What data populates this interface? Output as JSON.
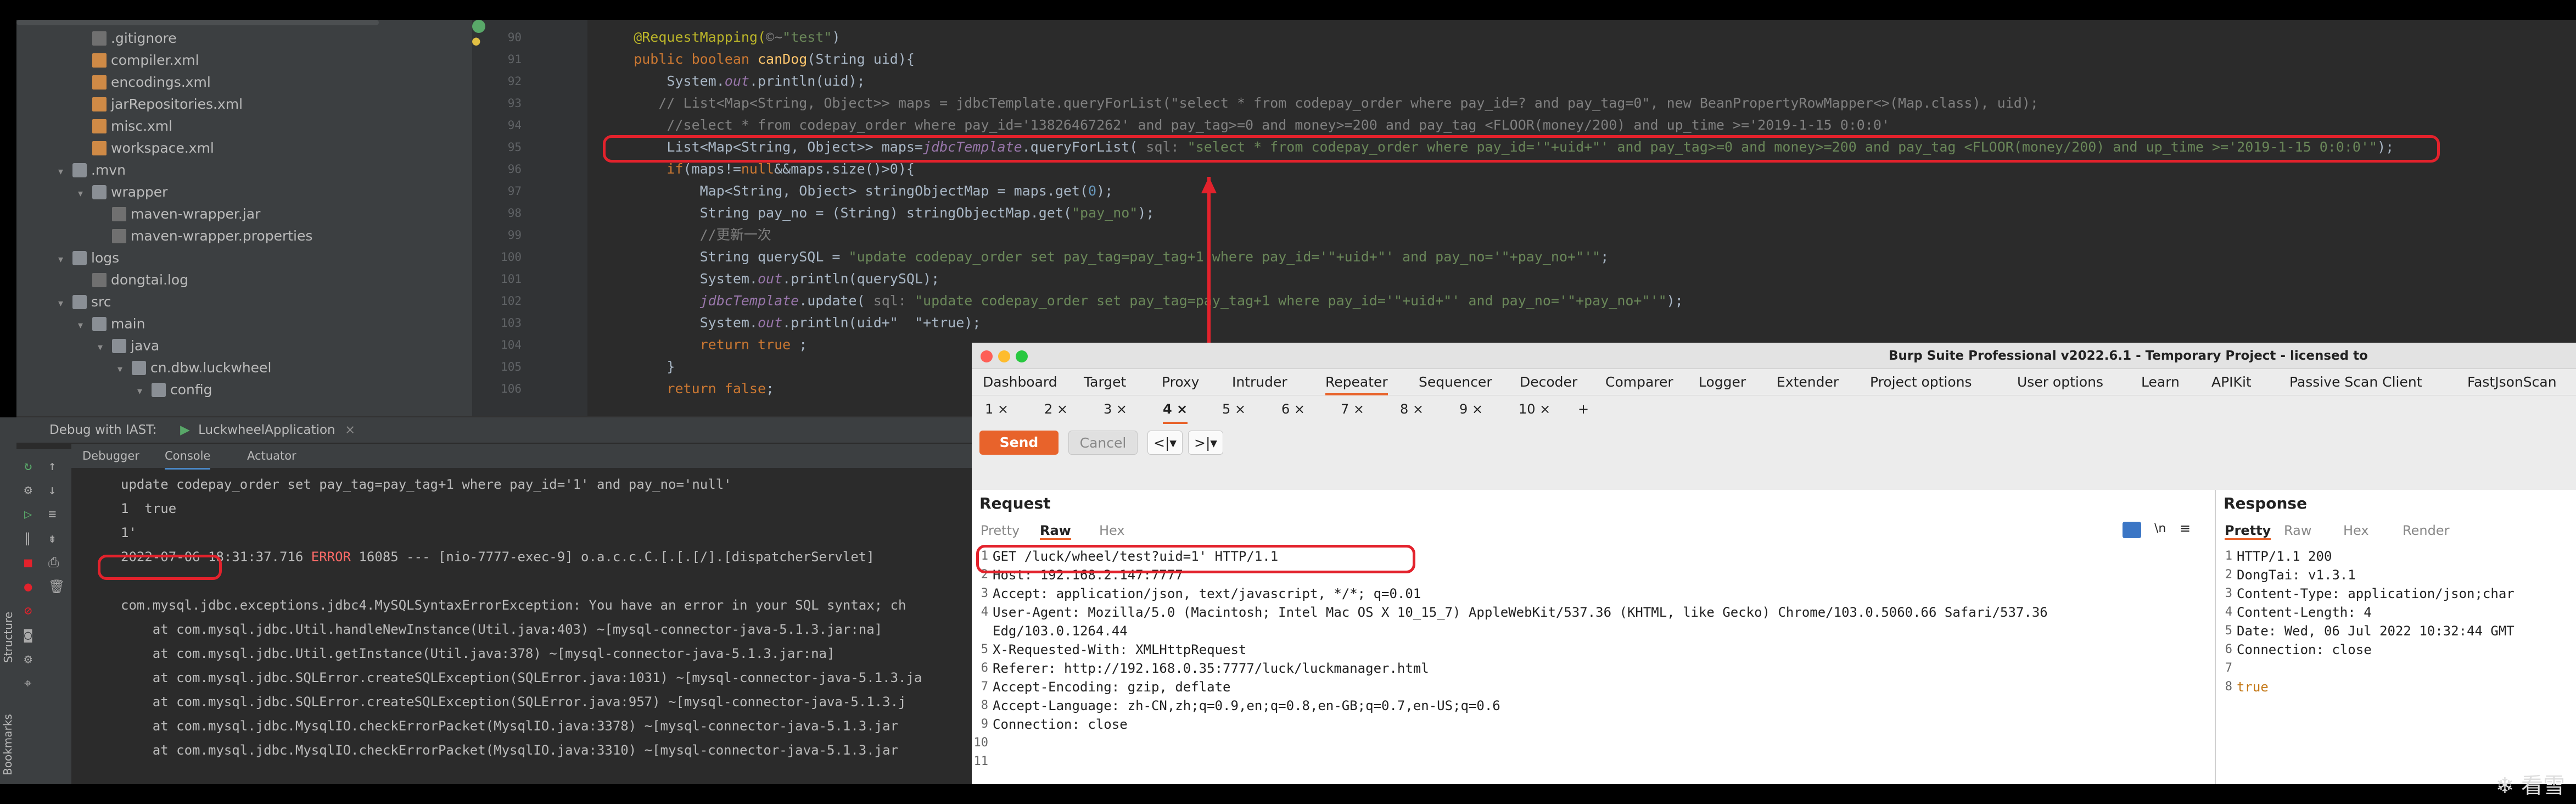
{
  "tree": [
    {
      "label": ".gitignore",
      "depth": 2,
      "icon": "file-icon",
      "arrow": ""
    },
    {
      "label": "compiler.xml",
      "depth": 2,
      "icon": "xml-file-icon",
      "arrow": ""
    },
    {
      "label": "encodings.xml",
      "depth": 2,
      "icon": "xml-file-icon",
      "arrow": ""
    },
    {
      "label": "jarRepositories.xml",
      "depth": 2,
      "icon": "xml-file-icon",
      "arrow": ""
    },
    {
      "label": "misc.xml",
      "depth": 2,
      "icon": "xml-file-icon",
      "arrow": ""
    },
    {
      "label": "workspace.xml",
      "depth": 2,
      "icon": "xml-file-icon",
      "arrow": ""
    },
    {
      "label": ".mvn",
      "depth": 1,
      "icon": "folder-icon",
      "arrow": "▾"
    },
    {
      "label": "wrapper",
      "depth": 2,
      "icon": "folder-icon",
      "arrow": "▾"
    },
    {
      "label": "maven-wrapper.jar",
      "depth": 3,
      "icon": "jar-file-icon",
      "arrow": ""
    },
    {
      "label": "maven-wrapper.properties",
      "depth": 3,
      "icon": "file-icon",
      "arrow": ""
    },
    {
      "label": "logs",
      "depth": 1,
      "icon": "folder-icon",
      "arrow": "▾"
    },
    {
      "label": "dongtai.log",
      "depth": 2,
      "icon": "file-icon",
      "arrow": ""
    },
    {
      "label": "src",
      "depth": 1,
      "icon": "folder-icon",
      "arrow": "▾"
    },
    {
      "label": "main",
      "depth": 2,
      "icon": "folder-icon",
      "arrow": "▾"
    },
    {
      "label": "java",
      "depth": 3,
      "icon": "folder-icon",
      "arrow": "▾"
    },
    {
      "label": "cn.dbw.luckwheel",
      "depth": 4,
      "icon": "folder-icon",
      "arrow": "▾"
    },
    {
      "label": "config",
      "depth": 5,
      "icon": "folder-icon",
      "arrow": "▾"
    }
  ],
  "editor": {
    "line_numbers": [
      "90",
      "91",
      "92",
      "93",
      "94",
      "95",
      "96",
      "97",
      "98",
      "99",
      "100",
      "101",
      "102",
      "103",
      "104",
      "105",
      "106"
    ],
    "lines": [
      [
        {
          "c": "an",
          "t": "    @RequestMapping("
        },
        {
          "c": "cm",
          "t": "©~"
        },
        {
          "c": "st",
          "t": "\"test\""
        },
        {
          "c": "",
          "t": ")"
        }
      ],
      [
        {
          "c": "kw",
          "t": "    public boolean "
        },
        {
          "c": "fn",
          "t": "canDog"
        },
        {
          "c": "",
          "t": "(String uid){"
        }
      ],
      [
        {
          "c": "",
          "t": "        System."
        },
        {
          "c": "it",
          "t": "out"
        },
        {
          "c": "",
          "t": ".println(uid);"
        }
      ],
      [
        {
          "c": "cm",
          "t": "       // List<Map<String, Object>> maps = jdbcTemplate.queryForList(\"select * from codepay_order where pay_id=? and pay_tag=0\", new BeanPropertyRowMapper<>(Map.class), uid);"
        }
      ],
      [
        {
          "c": "cm",
          "t": "        //select * from codepay_order where pay_id='13826467262' and pay_tag>=0 and money>=200 and pay_tag <FLOOR(money/200) and up_time >='2019-1-15 0:0:0'"
        }
      ],
      [
        {
          "c": "",
          "t": "        List<Map<String, Object>> maps="
        },
        {
          "c": "it",
          "t": "jdbcTemplate"
        },
        {
          "c": "",
          "t": ".queryForList( "
        },
        {
          "c": "cm",
          "t": "sql: "
        },
        {
          "c": "st",
          "t": "\"select * from codepay_order where pay_id='\"+uid+\"' and pay_tag>=0 and money>=200 and pay_tag <FLOOR(money/200) and up_time >='2019-1-15 0:0:0'\""
        },
        {
          "c": "",
          "t": ");"
        }
      ],
      [
        {
          "c": "kw",
          "t": "        if"
        },
        {
          "c": "",
          "t": "(maps!="
        },
        {
          "c": "kw",
          "t": "null"
        },
        {
          "c": "",
          "t": "&&maps.size()>0){"
        }
      ],
      [
        {
          "c": "",
          "t": "            Map<String, Object> stringObjectMap = maps.get("
        },
        {
          "c": "num",
          "t": "0"
        },
        {
          "c": "",
          "t": ");"
        }
      ],
      [
        {
          "c": "",
          "t": "            String pay_no = (String) stringObjectMap.get("
        },
        {
          "c": "st",
          "t": "\"pay_no\""
        },
        {
          "c": "",
          "t": ");"
        }
      ],
      [
        {
          "c": "cm",
          "t": "            //更新一次"
        }
      ],
      [
        {
          "c": "",
          "t": "            String querySQL = "
        },
        {
          "c": "st",
          "t": "\"update codepay_order set pay_tag=pay_tag+1 where pay_id='\"+uid+\"' and pay_no='\"+pay_no+\"'\""
        },
        {
          "c": "",
          "t": ";"
        }
      ],
      [
        {
          "c": "",
          "t": "            System."
        },
        {
          "c": "it",
          "t": "out"
        },
        {
          "c": "",
          "t": ".println(querySQL);"
        }
      ],
      [
        {
          "c": "it",
          "t": "            jdbcTemplate"
        },
        {
          "c": "",
          "t": ".update( "
        },
        {
          "c": "cm",
          "t": "sql: "
        },
        {
          "c": "st",
          "t": "\"update codepay_order set pay_tag=pay_tag+1 where pay_id='\"+uid+\"' and pay_no='\"+pay_no+\"'\""
        },
        {
          "c": "",
          "t": ");"
        }
      ],
      [
        {
          "c": "",
          "t": "            System."
        },
        {
          "c": "it",
          "t": "out"
        },
        {
          "c": "",
          "t": ".println(uid+\"  \"+true);"
        }
      ],
      [
        {
          "c": "kw",
          "t": "            return true "
        },
        {
          "c": "",
          "t": ";"
        }
      ],
      [
        {
          "c": "",
          "t": "        }"
        }
      ],
      [
        {
          "c": "kw",
          "t": "        return false"
        },
        {
          "c": "",
          "t": ";"
        }
      ]
    ]
  },
  "debug": {
    "title": "Debug with IAST:",
    "app_tab": "LuckwheelApplication",
    "tabs": [
      "Debugger",
      "Console",
      "Actuator"
    ],
    "console_lines": [
      {
        "c": "#bbbbbb",
        "t": "update codepay_order set pay_tag=pay_tag+1 where pay_id='1' and pay_no='null'"
      },
      {
        "c": "#bbbbbb",
        "t": "1  true"
      },
      {
        "c": "#bbbbbb",
        "t": "1'"
      },
      {
        "c": "#bbbbbb",
        "t": "2022-07-06 18:31:37.716 ERROR 16085 --- [nio-7777-exec-9] o.a.c.c.C.[.[.[/].[dispatcherServlet]"
      },
      {
        "c": "#bbbbbb",
        "t": ""
      },
      {
        "c": "#bbbbbb",
        "t": "com.mysql.jdbc.exceptions.jdbc4.MySQLSyntaxErrorException: You have an error in your SQL syntax; ch"
      },
      {
        "c": "#bbbbbb",
        "t": "    at com.mysql.jdbc.Util.handleNewInstance(Util.java:403) ~[mysql-connector-java-5.1.3.jar:na]"
      },
      {
        "c": "#bbbbbb",
        "t": "    at com.mysql.jdbc.Util.getInstance(Util.java:378) ~[mysql-connector-java-5.1.3.jar:na]"
      },
      {
        "c": "#bbbbbb",
        "t": "    at com.mysql.jdbc.SQLError.createSQLException(SQLError.java:1031) ~[mysql-connector-java-5.1.3.ja"
      },
      {
        "c": "#bbbbbb",
        "t": "    at com.mysql.jdbc.SQLError.createSQLException(SQLError.java:957) ~[mysql-connector-java-5.1.3.j"
      },
      {
        "c": "#bbbbbb",
        "t": "    at com.mysql.jdbc.MysqlIO.checkErrorPacket(MysqlIO.java:3378) ~[mysql-connector-java-5.1.3.jar"
      },
      {
        "c": "#bbbbbb",
        "t": "    at com.mysql.jdbc.MysqlIO.checkErrorPacket(MysqlIO.java:3310) ~[mysql-connector-java-5.1.3.jar"
      }
    ],
    "sidebar_labels": [
      "Structure",
      "Bookmarks"
    ]
  },
  "burp": {
    "title": "Burp Suite Professional v2022.6.1 - Temporary Project - licensed to",
    "tabs": [
      "Dashboard",
      "Target",
      "Proxy",
      "Intruder",
      "Repeater",
      "Sequencer",
      "Decoder",
      "Comparer",
      "Logger",
      "Extender",
      "Project options",
      "User options",
      "Learn",
      "APIKit",
      "Passive Scan Client",
      "FastJsonScan"
    ],
    "active_tab": "Repeater",
    "repeater_tabs": [
      "1 ×",
      "2 ×",
      "3 ×",
      "4 ×",
      "5 ×",
      "6 ×",
      "7 ×",
      "8 ×",
      "9 ×",
      "10 ×",
      "+"
    ],
    "active_repeater_tab": "4 ×",
    "send_label": "Send",
    "cancel_label": "Cancel",
    "request": {
      "heading": "Request",
      "view_tabs": [
        "Pretty",
        "Raw",
        "Hex"
      ],
      "active_view": "Raw",
      "newline_label": "\\n",
      "lines": [
        "GET /luck/wheel/test?uid=1' HTTP/1.1",
        "Host: 192.168.2.147:7777",
        "Accept: application/json, text/javascript, */*; q=0.01",
        "User-Agent: Mozilla/5.0 (Macintosh; Intel Mac OS X 10_15_7) AppleWebKit/537.36 (KHTML, like Gecko) Chrome/103.0.5060.66 Safari/537.36",
        "Edg/103.0.1264.44",
        "X-Requested-With: XMLHttpRequest",
        "Referer: http://192.168.0.35:7777/luck/luckmanager.html",
        "Accept-Encoding: gzip, deflate",
        "Accept-Language: zh-CN,zh;q=0.9,en;q=0.8,en-GB;q=0.7,en-US;q=0.6",
        "Connection: close",
        "",
        ""
      ],
      "line_numbers": [
        "1",
        "2",
        "3",
        "4",
        "",
        "5",
        "6",
        "7",
        "8",
        "9",
        "10",
        "11"
      ]
    },
    "response": {
      "heading": "Response",
      "view_tabs": [
        "Pretty",
        "Raw",
        "Hex",
        "Render"
      ],
      "active_view": "Pretty",
      "lines": [
        "HTTP/1.1 200",
        "DongTai: v1.3.1",
        "Content-Type: application/json;char",
        "Content-Length: 4",
        "Date: Wed, 06 Jul 2022 10:32:44 GMT",
        "Connection: close",
        "",
        "true"
      ],
      "line_numbers": [
        "1",
        "2",
        "3",
        "4",
        "5",
        "6",
        "7",
        "8"
      ]
    }
  },
  "watermark": "看雪",
  "colors": {
    "accent_red": "#e3222c",
    "burp_orange": "#e8632b",
    "ide_bg": "#2b2b2b",
    "error_red": "#ff6b68"
  }
}
